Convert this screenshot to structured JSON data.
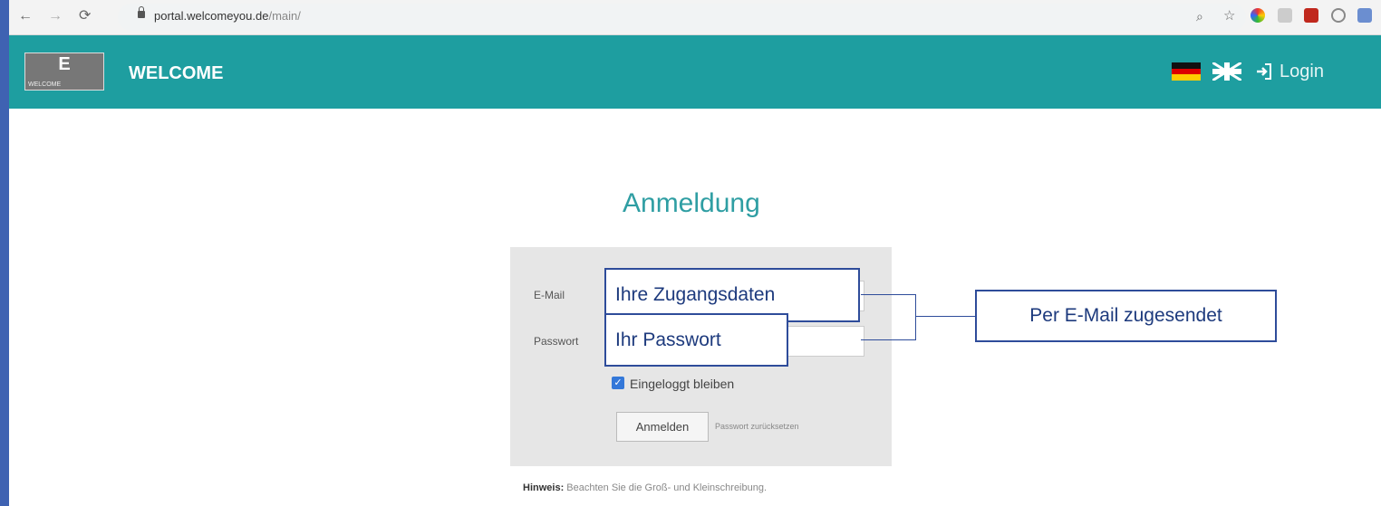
{
  "browser": {
    "url_host": "portal.welcomeyou.de",
    "url_path": "/main/",
    "back_icon": "back-arrow-icon",
    "forward_icon": "forward-arrow-icon",
    "reload_icon": "reload-icon"
  },
  "header": {
    "logo_letter": "E",
    "logo_caption": "WELCOME",
    "brand": "WELCOME",
    "login_label": "Login",
    "background": "#1e9ea0"
  },
  "form": {
    "title": "Anmeldung",
    "email_label": "E-Mail",
    "email_value": "Ihre Zugangsdaten",
    "password_label": "Passwort",
    "password_value": "Ihr Passwort",
    "remember_label": "Eingeloggt bleiben",
    "remember_checked": true,
    "submit_label": "Anmelden",
    "reset_label": "Passwort zurücksetzen",
    "hint_bold": "Hinweis:",
    "hint_text": " Beachten Sie die Groß- und Kleinschreibung."
  },
  "annotation": {
    "callout_text": "Per E-Mail zugesendet"
  },
  "colors": {
    "accent": "#1e9ea0",
    "annotation": "#2e4c9a",
    "side_border": "#3f62b2"
  }
}
